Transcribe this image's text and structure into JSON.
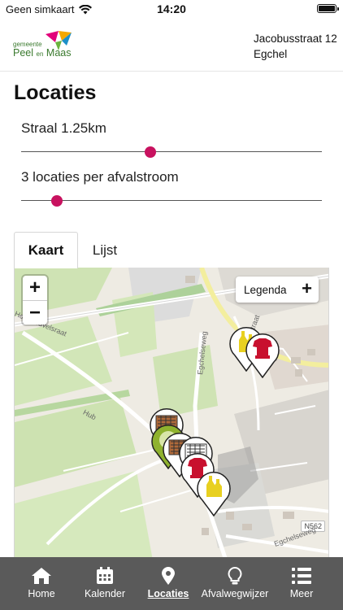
{
  "status_bar": {
    "carrier": "Geen simkaart",
    "time": "14:20",
    "battery_level": 1.0
  },
  "header": {
    "logo": {
      "small_text": "gemeente",
      "name_part1": "Peel",
      "name_part2": "en",
      "name_part3": "Maas",
      "colors": [
        "#e2007a",
        "#f5a800",
        "#1d8fc8",
        "#6cb33f"
      ]
    },
    "address_line1": "Jacobusstraat 12",
    "address_line2": "Egchel"
  },
  "page": {
    "title": "Locaties"
  },
  "sliders": [
    {
      "label": "Straal 1.25km",
      "fraction": 0.43
    },
    {
      "label": "3 locaties per afvalstroom",
      "fraction": 0.12
    }
  ],
  "accent_color": "#c8125f",
  "tabs": [
    {
      "label": "Kaart",
      "active": true
    },
    {
      "label": "Lijst",
      "active": false
    }
  ],
  "map": {
    "zoom_in": "+",
    "zoom_out": "−",
    "legend_label": "Legenda",
    "legend_toggle": "+",
    "street_labels": [
      "Hoogheuvelsraat",
      "Hub",
      "Egchelseweg",
      "Raadhuisstraat",
      "N562",
      "Egchelseweg"
    ],
    "markers": [
      "paper-container-icon",
      "glass-container-icon",
      "paper-container-icon",
      "textile-container-icon",
      "glass-container-icon",
      "glass-container-icon",
      "textile-container-icon"
    ]
  },
  "nav": [
    {
      "label": "Home",
      "icon": "home-icon",
      "active": false
    },
    {
      "label": "Kalender",
      "icon": "calendar-icon",
      "active": false
    },
    {
      "label": "Locaties",
      "icon": "location-pin-icon",
      "active": true
    },
    {
      "label": "Afvalwegwijzer",
      "icon": "lightbulb-icon",
      "active": false
    },
    {
      "label": "Meer",
      "icon": "menu-list-icon",
      "active": false
    }
  ]
}
